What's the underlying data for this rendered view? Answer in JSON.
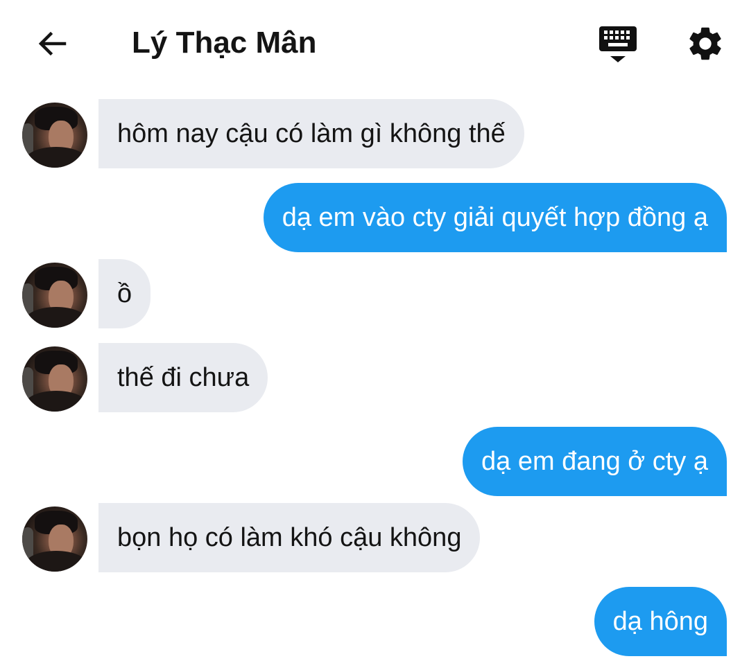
{
  "header": {
    "title": "Lý Thạc Mân",
    "back_icon": "arrow-left-icon",
    "keyboard_icon": "keyboard-hide-icon",
    "settings_icon": "gear-icon"
  },
  "colors": {
    "incoming_bubble": "#e9ebf0",
    "outgoing_bubble": "#1d9bf0",
    "background": "#ffffff",
    "text": "#141414"
  },
  "messages": [
    {
      "from": "contact",
      "text": "hôm nay cậu có làm gì không thế"
    },
    {
      "from": "me",
      "text": "dạ em vào cty giải quyết hợp đồng ạ"
    },
    {
      "from": "contact",
      "text": "ồ"
    },
    {
      "from": "contact",
      "text": "thế đi chưa"
    },
    {
      "from": "me",
      "text": "dạ em đang ở cty ạ"
    },
    {
      "from": "contact",
      "text": "bọn họ có làm khó cậu không"
    },
    {
      "from": "me",
      "text": "dạ hông"
    }
  ]
}
